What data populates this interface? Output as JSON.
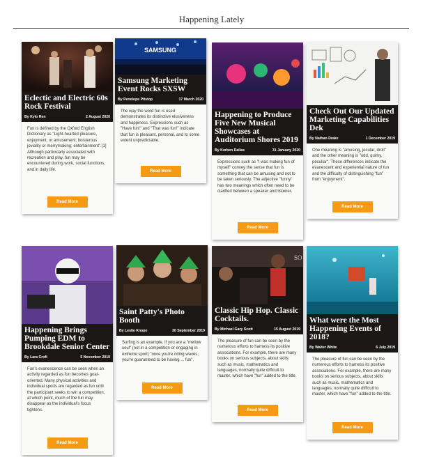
{
  "section": {
    "title": "Happening Lately"
  },
  "read_more": "Read More",
  "colors": {
    "accent": "#f59a12",
    "header_bg": "#1b1716"
  },
  "posts": [
    {
      "title": "Eclectic and Electric 60s Rock Festival",
      "author": "By Kylo Ren",
      "date": "2 August 2020",
      "excerpt": "Fun is defined by the Oxford English Dictionary as \"Light-hearted pleasure, enjoyment, or amusement; boisterous joviality or merrymaking; entertainment\".[1] Although particularly associated with recreation and play, fun may be encountered during work, social functions, and in daily life."
    },
    {
      "title": "Samsung Marketing Event Rocks SXSW",
      "author": "By Penelope Pitstop",
      "date": "17 March 2020",
      "excerpt": "The way the word fun is used demonstrates its distinctive elusiveness and happiness. Expressions such as \"Have fun!\" and \"That was fun!\" indicate that fun is pleasant, personal, and to some extent unpredictable."
    },
    {
      "title": "Happening to Produce Five New Musical Showcases at Auditorium Shores 2019",
      "author": "By Korben Dallas",
      "date": "31 January 2020",
      "excerpt": "Expressions such as \"I was making fun of myself\" convey the sense that fun is something that can be amusing and not to be taken seriously. The adjective \"funny\" has two meanings which often need to be clarified between a speaker and listener."
    },
    {
      "title": "Check Out Our Updated Marketing Capabilities Dek",
      "author": "By Nathan Drake",
      "date": "1 December 2019",
      "excerpt": "One meaning is \"amusing, jocular, droll\" and the other meaning is \"odd, quirky, peculiar\". These differences indicate the evanescent and experiential nature of fun and the difficulty of distinguishing \"fun\" from \"enjoyment\"."
    },
    {
      "title": "Happening Brings Pumping EDM to Brookdale Senior Center",
      "author": "By Lara Croft",
      "date": "5 November 2019",
      "excerpt": "Fun's evanescence can be seen when an activity regarded as fun becomes goal-oriented. Many physical activities and individual sports are regarded as fun until the participant seeks to win a competition, at which point, much of the fun may disappear as the individual's focus tightens."
    },
    {
      "title": "Saint Patty's Photo Booth",
      "author": "By Leslie Knope",
      "date": "30 September 2019",
      "excerpt": "Surfing is an example. If you are a \"mellow soul\" (not in a competition or engaging in extreme sport) \"once you're riding waves, you're guaranteed to be having ... fun\"."
    },
    {
      "title": "Classic Hip Hop. Classic Cocktails.",
      "author": "By Michael Gary Scott",
      "date": "15 August 2019",
      "excerpt": "The pleasure of fun can be seen by the numerous efforts to harness its positive associations. For example, there are many books on serious subjects, about skills such as music, mathematics and languages, normally quite difficult to master, which have \"fun\" added to the title."
    },
    {
      "title": "What were the Most Happening Events of 2018?",
      "author": "By Walter White",
      "date": "6 July 2019",
      "excerpt": "The pleasure of fun can be seen by the numerous efforts to harness its positive associations. For example, there are many books on serious subjects, about skills such as music, mathematics and languages, normally quite difficult to master, which have \"fun\" added to the title."
    }
  ]
}
